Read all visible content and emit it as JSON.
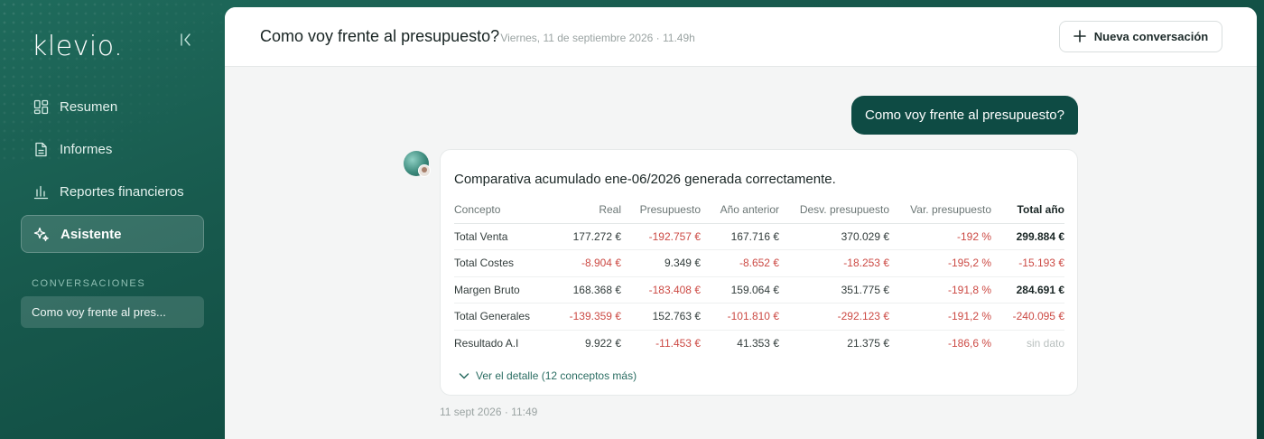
{
  "sidebar": {
    "logo": "klevio.",
    "nav": [
      {
        "label": "Resumen",
        "icon": "dashboard-icon",
        "active": false
      },
      {
        "label": "Informes",
        "icon": "document-icon",
        "active": false
      },
      {
        "label": "Reportes financieros",
        "icon": "bar-chart-icon",
        "active": false
      },
      {
        "label": "Asistente",
        "icon": "sparkles-icon",
        "active": true
      }
    ],
    "section_label": "CONVERSACIONES",
    "conversations": [
      {
        "label": "Como voy frente al pres..."
      }
    ]
  },
  "header": {
    "title": "Como voy frente al presupuesto?",
    "meta": "· Viernes, 11 de septiembre 2026 · 11.49h",
    "new_button": "Nueva conversación"
  },
  "chat": {
    "user_message": "Como voy frente al presupuesto?",
    "assistant": {
      "headline": "Comparativa acumulado ene-06/2026 generada correctamente.",
      "table": {
        "columns": [
          "Concepto",
          "Real",
          "Presupuesto",
          "Año anterior",
          "Desv. presupuesto",
          "Var. presupuesto",
          "Total año"
        ],
        "rows": [
          [
            "Total Venta",
            "177.272 €",
            "-192.757 €",
            "167.716 €",
            "370.029 €",
            "-192 %",
            "299.884 €"
          ],
          [
            "Total Costes",
            "-8.904 €",
            "9.349 €",
            "-8.652 €",
            "-18.253 €",
            "-195,2 %",
            "-15.193 €"
          ],
          [
            "Margen Bruto",
            "168.368 €",
            "-183.408 €",
            "159.064 €",
            "351.775 €",
            "-191,8 %",
            "284.691 €"
          ],
          [
            "Total Generales",
            "-139.359 €",
            "152.763 €",
            "-101.810 €",
            "-292.123 €",
            "-191,2 %",
            "-240.095 €"
          ],
          [
            "Resultado A.I",
            "9.922 €",
            "-11.453 €",
            "41.353 €",
            "21.375 €",
            "-186,6 %",
            "sin dato"
          ]
        ]
      },
      "detail_link": "Ver el detalle (12 conceptos más)",
      "timestamp": "11 sept 2026 · 11:49"
    }
  },
  "colors": {
    "accent": "#0e4b44",
    "negative": "#cc4a44",
    "sidebar_bg": "#17584c"
  }
}
